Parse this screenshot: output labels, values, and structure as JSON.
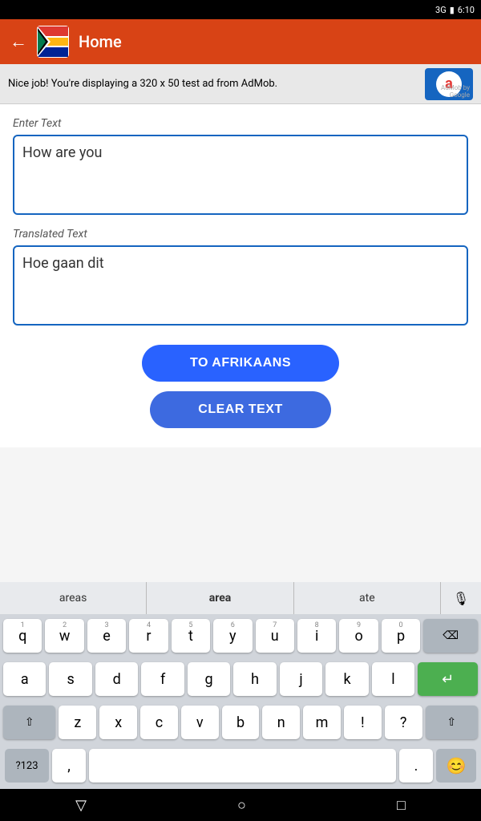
{
  "statusBar": {
    "signal": "3G",
    "battery": "🔋",
    "time": "6:10"
  },
  "topBar": {
    "backLabel": "←",
    "title": "Home"
  },
  "ad": {
    "text": "Nice job! You're displaying a 320 x 50 test ad from AdMob.",
    "logoText": "a",
    "byGoogle": "AdMob by Google"
  },
  "enterTextLabel": "Enter Text",
  "inputText": "How are you",
  "translatedTextLabel": "Translated Text",
  "translatedText": "Hoe gaan dit",
  "buttons": {
    "translate": "TO AFRIKAANS",
    "clear": "CLEAR TEXT"
  },
  "keyboard": {
    "suggestions": [
      "areas",
      "area",
      "ate"
    ],
    "rows": [
      [
        "q",
        "w",
        "e",
        "r",
        "t",
        "y",
        "u",
        "i",
        "o",
        "p"
      ],
      [
        "a",
        "s",
        "d",
        "f",
        "g",
        "h",
        "j",
        "k",
        "l"
      ],
      [
        "z",
        "x",
        "c",
        "v",
        "b",
        "n",
        "m"
      ]
    ],
    "numbers": [
      "1",
      "2",
      "3",
      "4",
      "5",
      "6",
      "7",
      "8",
      "9",
      "0"
    ],
    "specialBottom": "?123",
    "comma": ",",
    "period": ".",
    "emojiLabel": "😊"
  },
  "bottomNav": {
    "back": "▽",
    "home": "○",
    "recent": "□"
  }
}
